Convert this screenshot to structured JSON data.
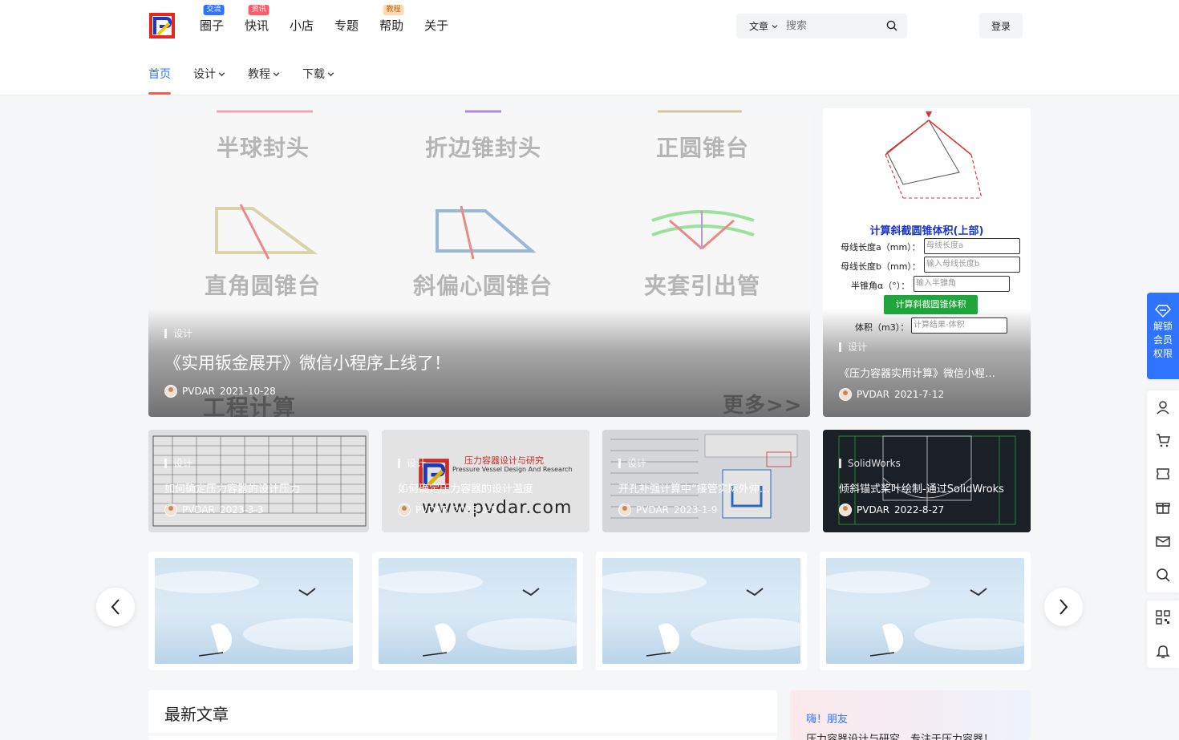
{
  "brand": {
    "accent": "#2f74ff",
    "red": "#ff5b4a"
  },
  "topnav": [
    {
      "label": "圈子",
      "badge": "交流"
    },
    {
      "label": "快讯",
      "badge": "资讯"
    },
    {
      "label": "小店",
      "badge": ""
    },
    {
      "label": "专题",
      "badge": ""
    },
    {
      "label": "帮助",
      "badge": "教程"
    },
    {
      "label": "关于",
      "badge": ""
    }
  ],
  "search": {
    "type": "文章",
    "placeholder": "搜索"
  },
  "login": "登录",
  "subnav": [
    "首页",
    "设计",
    "教程",
    "下载"
  ],
  "hero_main": {
    "shapes": [
      "半球封头",
      "折边锥封头",
      "正圆锥台",
      "直角圆锥台",
      "斜偏心圆锥台",
      "夹套引出管"
    ],
    "overlay_bottom_left": "工程计算",
    "overlay_bottom_right": "更多>>",
    "category": "设计",
    "title": "《实用钣金展开》微信小程序上线了！",
    "author": "PVDAR",
    "date": "2021-10-28"
  },
  "hero_side": {
    "calc": {
      "title": "计算斜截圆锥体积(上部)",
      "row1_label": "母线长度a（mm）：",
      "row1_placeholder": "母线长度a",
      "row2_label": "母线长度b（mm）：",
      "row2_placeholder": "输入母线长度b",
      "row3_label": "半锥角α（°）：",
      "row3_placeholder": "输入半锥角",
      "button": "计算斜截圆锥体积",
      "row4_label": "体积（m3）：",
      "row4_placeholder": "计算结果-体积"
    },
    "category": "设计",
    "title": "《压力容器实用计算》微信小程…",
    "author": "PVDAR",
    "date": "2021-7-12"
  },
  "cards": [
    {
      "category": "设计",
      "title": "如何确定压力容器的设计压力",
      "author": "PVDAR",
      "date": "2023-3-3"
    },
    {
      "category": "设计",
      "title": "如何确定压力容器的设计温度",
      "author": "PVDAR",
      "date": "2023-3-8",
      "logo_line1": "压力容器设计与研究",
      "logo_line2": "Pressure Vessel Design And Research",
      "logo_url": "www.pvdar.com"
    },
    {
      "category": "设计",
      "title": "开孔补强计算中“接管实际外伸…",
      "author": "PVDAR",
      "date": "2023-1-9"
    },
    {
      "category": "SolidWorks",
      "title": "倾斜锚式桨叶绘制-通过SolidWroks",
      "author": "PVDAR",
      "date": "2022-8-27"
    }
  ],
  "latest": {
    "heading": "最新文章"
  },
  "hello": {
    "greeting": "嗨！朋友",
    "desc": "压力容器设计与研究，专注于压力容器！"
  },
  "vip": {
    "l1": "解锁",
    "l2": "会员",
    "l3": "权限"
  }
}
